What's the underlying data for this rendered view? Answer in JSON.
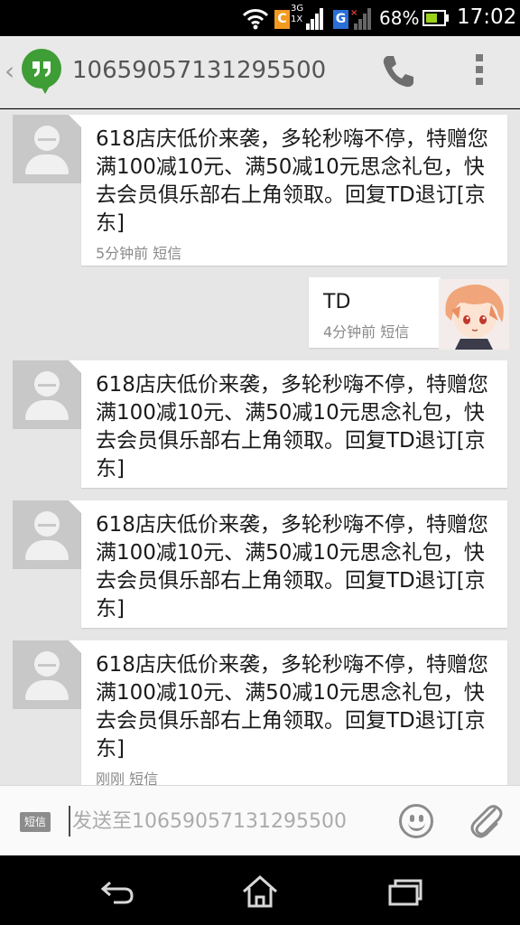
{
  "status_bar": {
    "carrier_badge_1": "C",
    "net_top": "3G",
    "net_bottom": "1X",
    "carrier_badge_2": "G",
    "battery_percent": "68%",
    "battery_level": 0.68,
    "time": "17:02"
  },
  "header": {
    "back_glyph": "‹",
    "title": "10659057131295500"
  },
  "messages": [
    {
      "direction": "incoming",
      "text": "618店庆低价来袭，多轮秒嗨不停，特赠您满100减10元、满50减10元思念礼包，快去会员俱乐部右上角领取。回复TD退订[京东]",
      "meta": "5分钟前 短信"
    },
    {
      "direction": "outgoing",
      "text": "TD",
      "meta": "4分钟前 短信"
    },
    {
      "direction": "incoming",
      "text": "618店庆低价来袭，多轮秒嗨不停，特赠您满100减10元、满50减10元思念礼包，快去会员俱乐部右上角领取。回复TD退订[京东]",
      "meta": ""
    },
    {
      "direction": "incoming",
      "text": "618店庆低价来袭，多轮秒嗨不停，特赠您满100减10元、满50减10元思念礼包，快去会员俱乐部右上角领取。回复TD退订[京东]",
      "meta": ""
    },
    {
      "direction": "incoming",
      "text": "618店庆低价来袭，多轮秒嗨不停，特赠您满100减10元、满50减10元思念礼包，快去会员俱乐部右上角领取。回复TD退订[京东]",
      "meta": "刚刚 短信"
    }
  ],
  "compose": {
    "sms_badge": "短信",
    "placeholder": "发送至10659057131295500"
  },
  "icons": {
    "header": [
      "hangouts-logo-icon",
      "phone-icon",
      "overflow-menu-icon"
    ],
    "compose": [
      "smiley-icon",
      "paperclip-icon"
    ],
    "nav": [
      "back-icon",
      "home-icon",
      "recents-icon"
    ]
  }
}
